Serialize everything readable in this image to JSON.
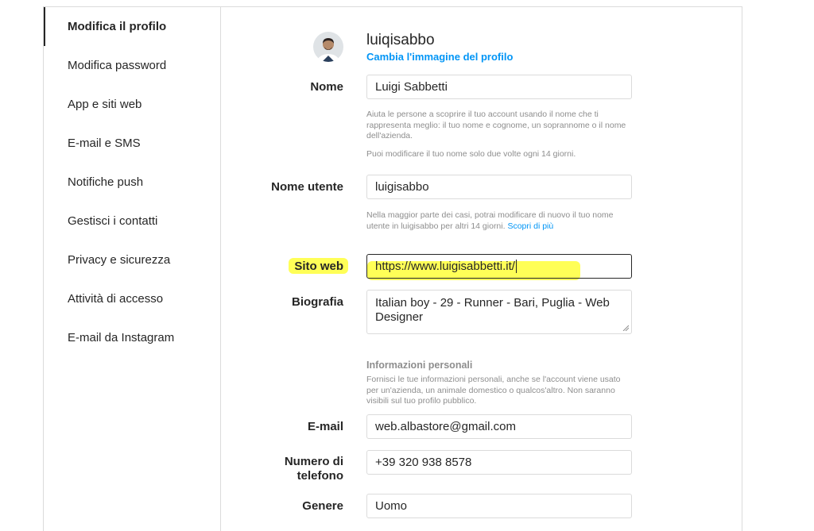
{
  "sidebar": {
    "items": [
      {
        "label": "Modifica il profilo",
        "active": true
      },
      {
        "label": "Modifica password"
      },
      {
        "label": "App e siti web"
      },
      {
        "label": "E-mail e SMS"
      },
      {
        "label": "Notifiche push"
      },
      {
        "label": "Gestisci i contatti"
      },
      {
        "label": "Privacy e sicurezza"
      },
      {
        "label": "Attività di accesso"
      },
      {
        "label": "E-mail da Instagram"
      }
    ]
  },
  "profile": {
    "username": "luiqisabbo",
    "change_photo": "Cambia l'immagine del profilo"
  },
  "form": {
    "name": {
      "label": "Nome",
      "value": "Luigi Sabbetti",
      "help1": "Aiuta le persone a scoprire il tuo account usando il nome che ti rappresenta meglio: il tuo nome e cognome, un soprannome o il nome dell'azienda.",
      "help2": "Puoi modificare il tuo nome solo due volte ogni 14 giorni."
    },
    "username": {
      "label": "Nome utente",
      "value": "luigisabbo",
      "help": "Nella maggior parte dei casi, potrai modificare di nuovo il tuo nome utente in luigisabbo per altri 14 giorni.",
      "help_link": "Scopri di più"
    },
    "website": {
      "label": "Sito web",
      "value": "https://www.luigisabbetti.it/"
    },
    "bio": {
      "label": "Biografia",
      "value": "Italian boy - 29 - Runner - Bari, Puglia - Web Designer"
    },
    "personal_info": {
      "title": "Informazioni personali",
      "help": "Fornisci le tue informazioni personali, anche se l'account viene usato per un'azienda, un animale domestico o qualcos'altro. Non saranno visibili sul tuo profilo pubblico."
    },
    "email": {
      "label": "E-mail",
      "value": "web.albastore@gmail.com"
    },
    "phone": {
      "label_line1": "Numero di",
      "label_line2": "telefono",
      "value": "+39 320 938 8578"
    },
    "gender": {
      "label": "Genere",
      "value": "Uomo"
    }
  },
  "colors": {
    "accent": "#0095f6",
    "border": "#dbdbdb",
    "muted": "#8e8e8e",
    "highlight": "#ffff3a"
  }
}
